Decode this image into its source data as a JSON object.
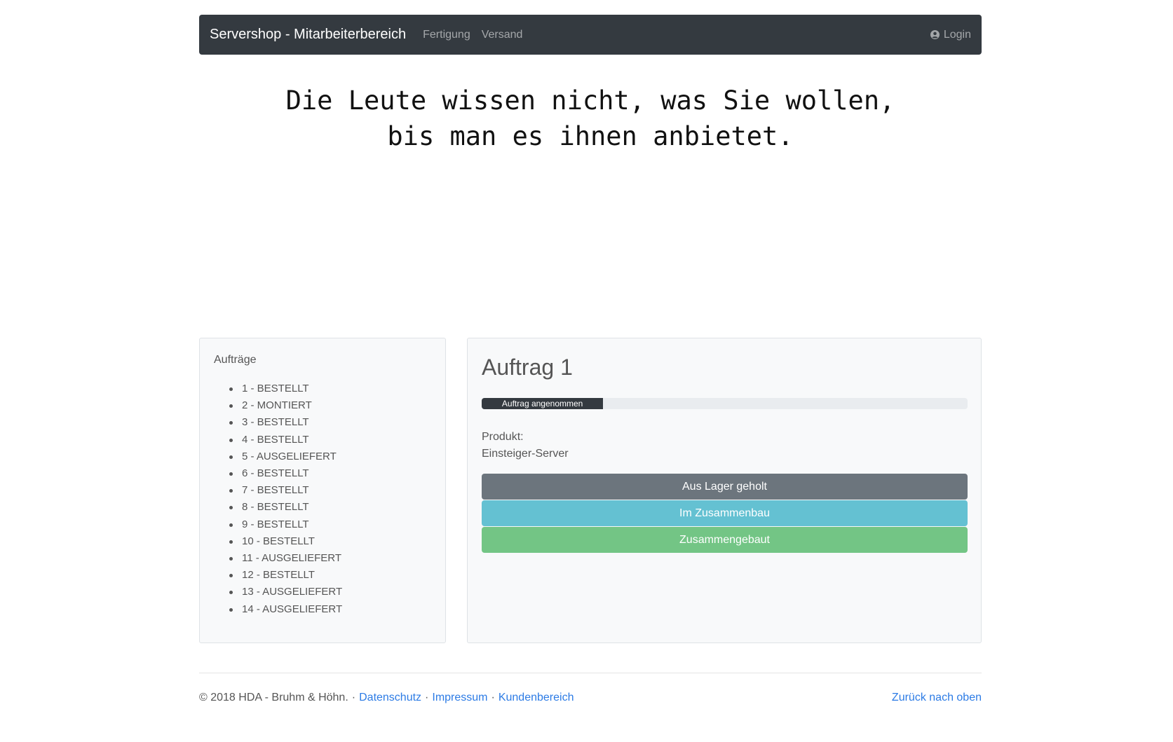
{
  "navbar": {
    "brand": "Servershop - Mitarbeiterbereich",
    "links": [
      "Fertigung",
      "Versand"
    ],
    "login_label": "Login",
    "login_icon": "user-circle-icon"
  },
  "quote": {
    "line1": "Die Leute wissen nicht, was Sie wollen,",
    "line2": "bis man es ihnen anbietet."
  },
  "orders": {
    "title": "Aufträge",
    "items": [
      "1 - BESTELLT",
      "2 - MONTIERT",
      "3 - BESTELLT",
      "4 - BESTELLT",
      "5 - AUSGELIEFERT",
      "6 - BESTELLT",
      "7 - BESTELLT",
      "8 - BESTELLT",
      "9 - BESTELLT",
      "10 - BESTELLT",
      "11 - AUSGELIEFERT",
      "12 - BESTELLT",
      "13 - AUSGELIEFERT",
      "14 - AUSGELIEFERT"
    ]
  },
  "detail": {
    "title": "Auftrag 1",
    "progress_label": "Auftrag angenommen",
    "progress_percent": 25,
    "product_label": "Produkt:",
    "product_value": "Einsteiger-Server",
    "buttons": [
      "Aus Lager geholt",
      "Im Zusammenbau",
      "Zusammengebaut"
    ]
  },
  "footer": {
    "copyright": "© 2018 HDA - Bruhm & Höhn.",
    "separator": "·",
    "links": [
      "Datenschutz",
      "Impressum",
      "Kundenbereich"
    ],
    "back_to_top": "Zurück nach oben"
  },
  "colors": {
    "navbar_bg": "#343a40",
    "btn_secondary": "#6c757d",
    "btn_info": "#64c1d2",
    "btn_success": "#73c585",
    "link": "#2c7be5"
  }
}
